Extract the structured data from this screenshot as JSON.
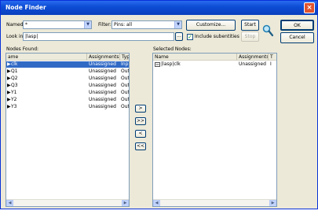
{
  "window": {
    "title": "Node Finder",
    "close_glyph": "×"
  },
  "filters": {
    "named_label": "Named:",
    "named_value": "*",
    "filter_label": "Filter:",
    "filter_value": "Pins: all",
    "look_in_label": "Look in:",
    "look_in_value": "|lasp|",
    "browse_label": "...",
    "include_subentities_label": "Include subentities",
    "include_subentities_checked": true
  },
  "buttons": {
    "customize": "Customize...",
    "start": "Start",
    "stop": "Stop",
    "ok": "OK",
    "cancel": "Cancel"
  },
  "nodes_found": {
    "label": "Nodes Found:",
    "columns": [
      "ame",
      "Assignments",
      "Typ"
    ],
    "rows": [
      {
        "name": "clk",
        "assignments": "Unassigned",
        "type": "Inp",
        "selected": true
      },
      {
        "name": "Q1",
        "assignments": "Unassigned",
        "type": "Outp",
        "selected": false
      },
      {
        "name": "Q2",
        "assignments": "Unassigned",
        "type": "Outp",
        "selected": false
      },
      {
        "name": "Q3",
        "assignments": "Unassigned",
        "type": "Outp",
        "selected": false
      },
      {
        "name": "Y1",
        "assignments": "Unassigned",
        "type": "Outp",
        "selected": false
      },
      {
        "name": "Y2",
        "assignments": "Unassigned",
        "type": "Outp",
        "selected": false
      },
      {
        "name": "Y3",
        "assignments": "Unassigned",
        "type": "Outp",
        "selected": false
      }
    ]
  },
  "move_buttons": {
    "add": ">",
    "add_all": ">>",
    "remove": "<",
    "remove_all": "<<"
  },
  "selected_nodes": {
    "label": "Selected Nodes:",
    "columns": [
      "Name",
      "Assignments",
      "T"
    ],
    "rows": [
      {
        "name": "|lasp|clk",
        "assignments": "Unassigned",
        "type": "I"
      }
    ]
  },
  "scroll_glyphs": {
    "up": "▲",
    "down": "▼",
    "left": "◀",
    "right": "▶"
  },
  "colors": {
    "title_bar": "#0d4ed6",
    "selection": "#316ac5",
    "face": "#ece9d8"
  }
}
